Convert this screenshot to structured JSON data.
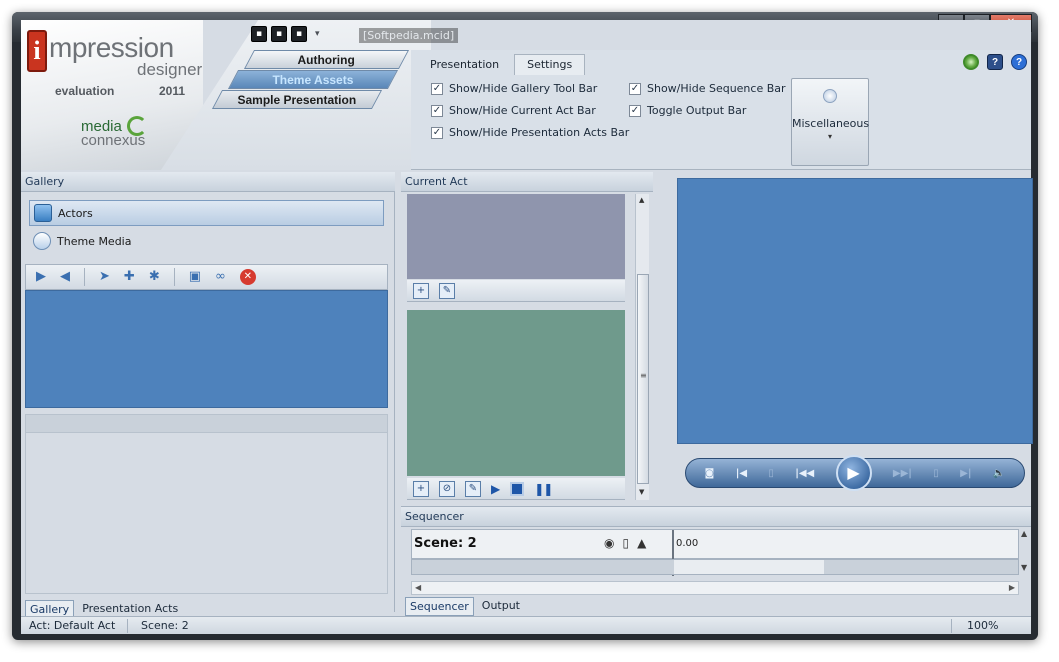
{
  "window": {
    "document_title": "[Softpedia.mcid]",
    "controls": {
      "minimize": "–",
      "maximize": "▫",
      "close": "✕"
    }
  },
  "logo": {
    "brand_letter": "i",
    "brand_rest": "mpression",
    "designer": "designer",
    "edition": "evaluation",
    "year": "2011",
    "company_a": "media",
    "company_b": "connexus"
  },
  "quick_access": {
    "buttons": [
      "▪",
      "▪",
      "▪"
    ],
    "dropdown": "▾"
  },
  "nav": {
    "authoring": "Authoring",
    "theme_assets": "Theme Assets",
    "sample_presentation": "Sample Presentation"
  },
  "ribbon": {
    "tabs": [
      {
        "label": "Presentation",
        "active": false
      },
      {
        "label": "Settings",
        "active": true
      }
    ],
    "checks": [
      {
        "label": "Show/Hide Gallery Tool Bar",
        "checked": true
      },
      {
        "label": "Show/Hide Current Act Bar",
        "checked": true
      },
      {
        "label": "Show/Hide Presentation Acts Bar",
        "checked": true
      },
      {
        "label": "Show/Hide Sequence Bar",
        "checked": true
      },
      {
        "label": "Toggle Output Bar",
        "checked": true
      }
    ],
    "misc_label": "Miscellaneous",
    "misc_arrow": "▾",
    "help_icons": {
      "refresh": "",
      "help_box": "?",
      "help_round": "?"
    }
  },
  "gallery": {
    "title": "Gallery",
    "items": [
      {
        "label": "Actors",
        "selected": true
      },
      {
        "label": "Theme Media",
        "selected": false
      }
    ],
    "toolbar_remove": "✕",
    "bottom_tabs": [
      {
        "label": "Gallery",
        "active": true
      },
      {
        "label": "Presentation Acts",
        "active": false
      }
    ]
  },
  "current_act": {
    "title": "Current Act",
    "scroll_up": "▲",
    "scroll_down": "▼",
    "scroll_grip": "≡"
  },
  "transport": {
    "buttons": [
      "◙",
      "|◀",
      "▯",
      "|◀◀",
      "▶",
      "▶▶|",
      "▯",
      "▶|",
      "🔈"
    ]
  },
  "sequencer": {
    "title": "Sequencer",
    "scene": "Scene: 2",
    "time": "0.00",
    "bottom_tabs": [
      {
        "label": "Sequencer",
        "active": true
      },
      {
        "label": "Output",
        "active": false
      }
    ]
  },
  "status": {
    "act": "Act: Default Act",
    "scene": "Scene: 2",
    "zoom": "100%"
  },
  "colors": {
    "preview_blue": "#4e82bc",
    "act_top": "#8f95ad",
    "act_green": "#6f9a8c",
    "accent_red": "#c9341f"
  }
}
